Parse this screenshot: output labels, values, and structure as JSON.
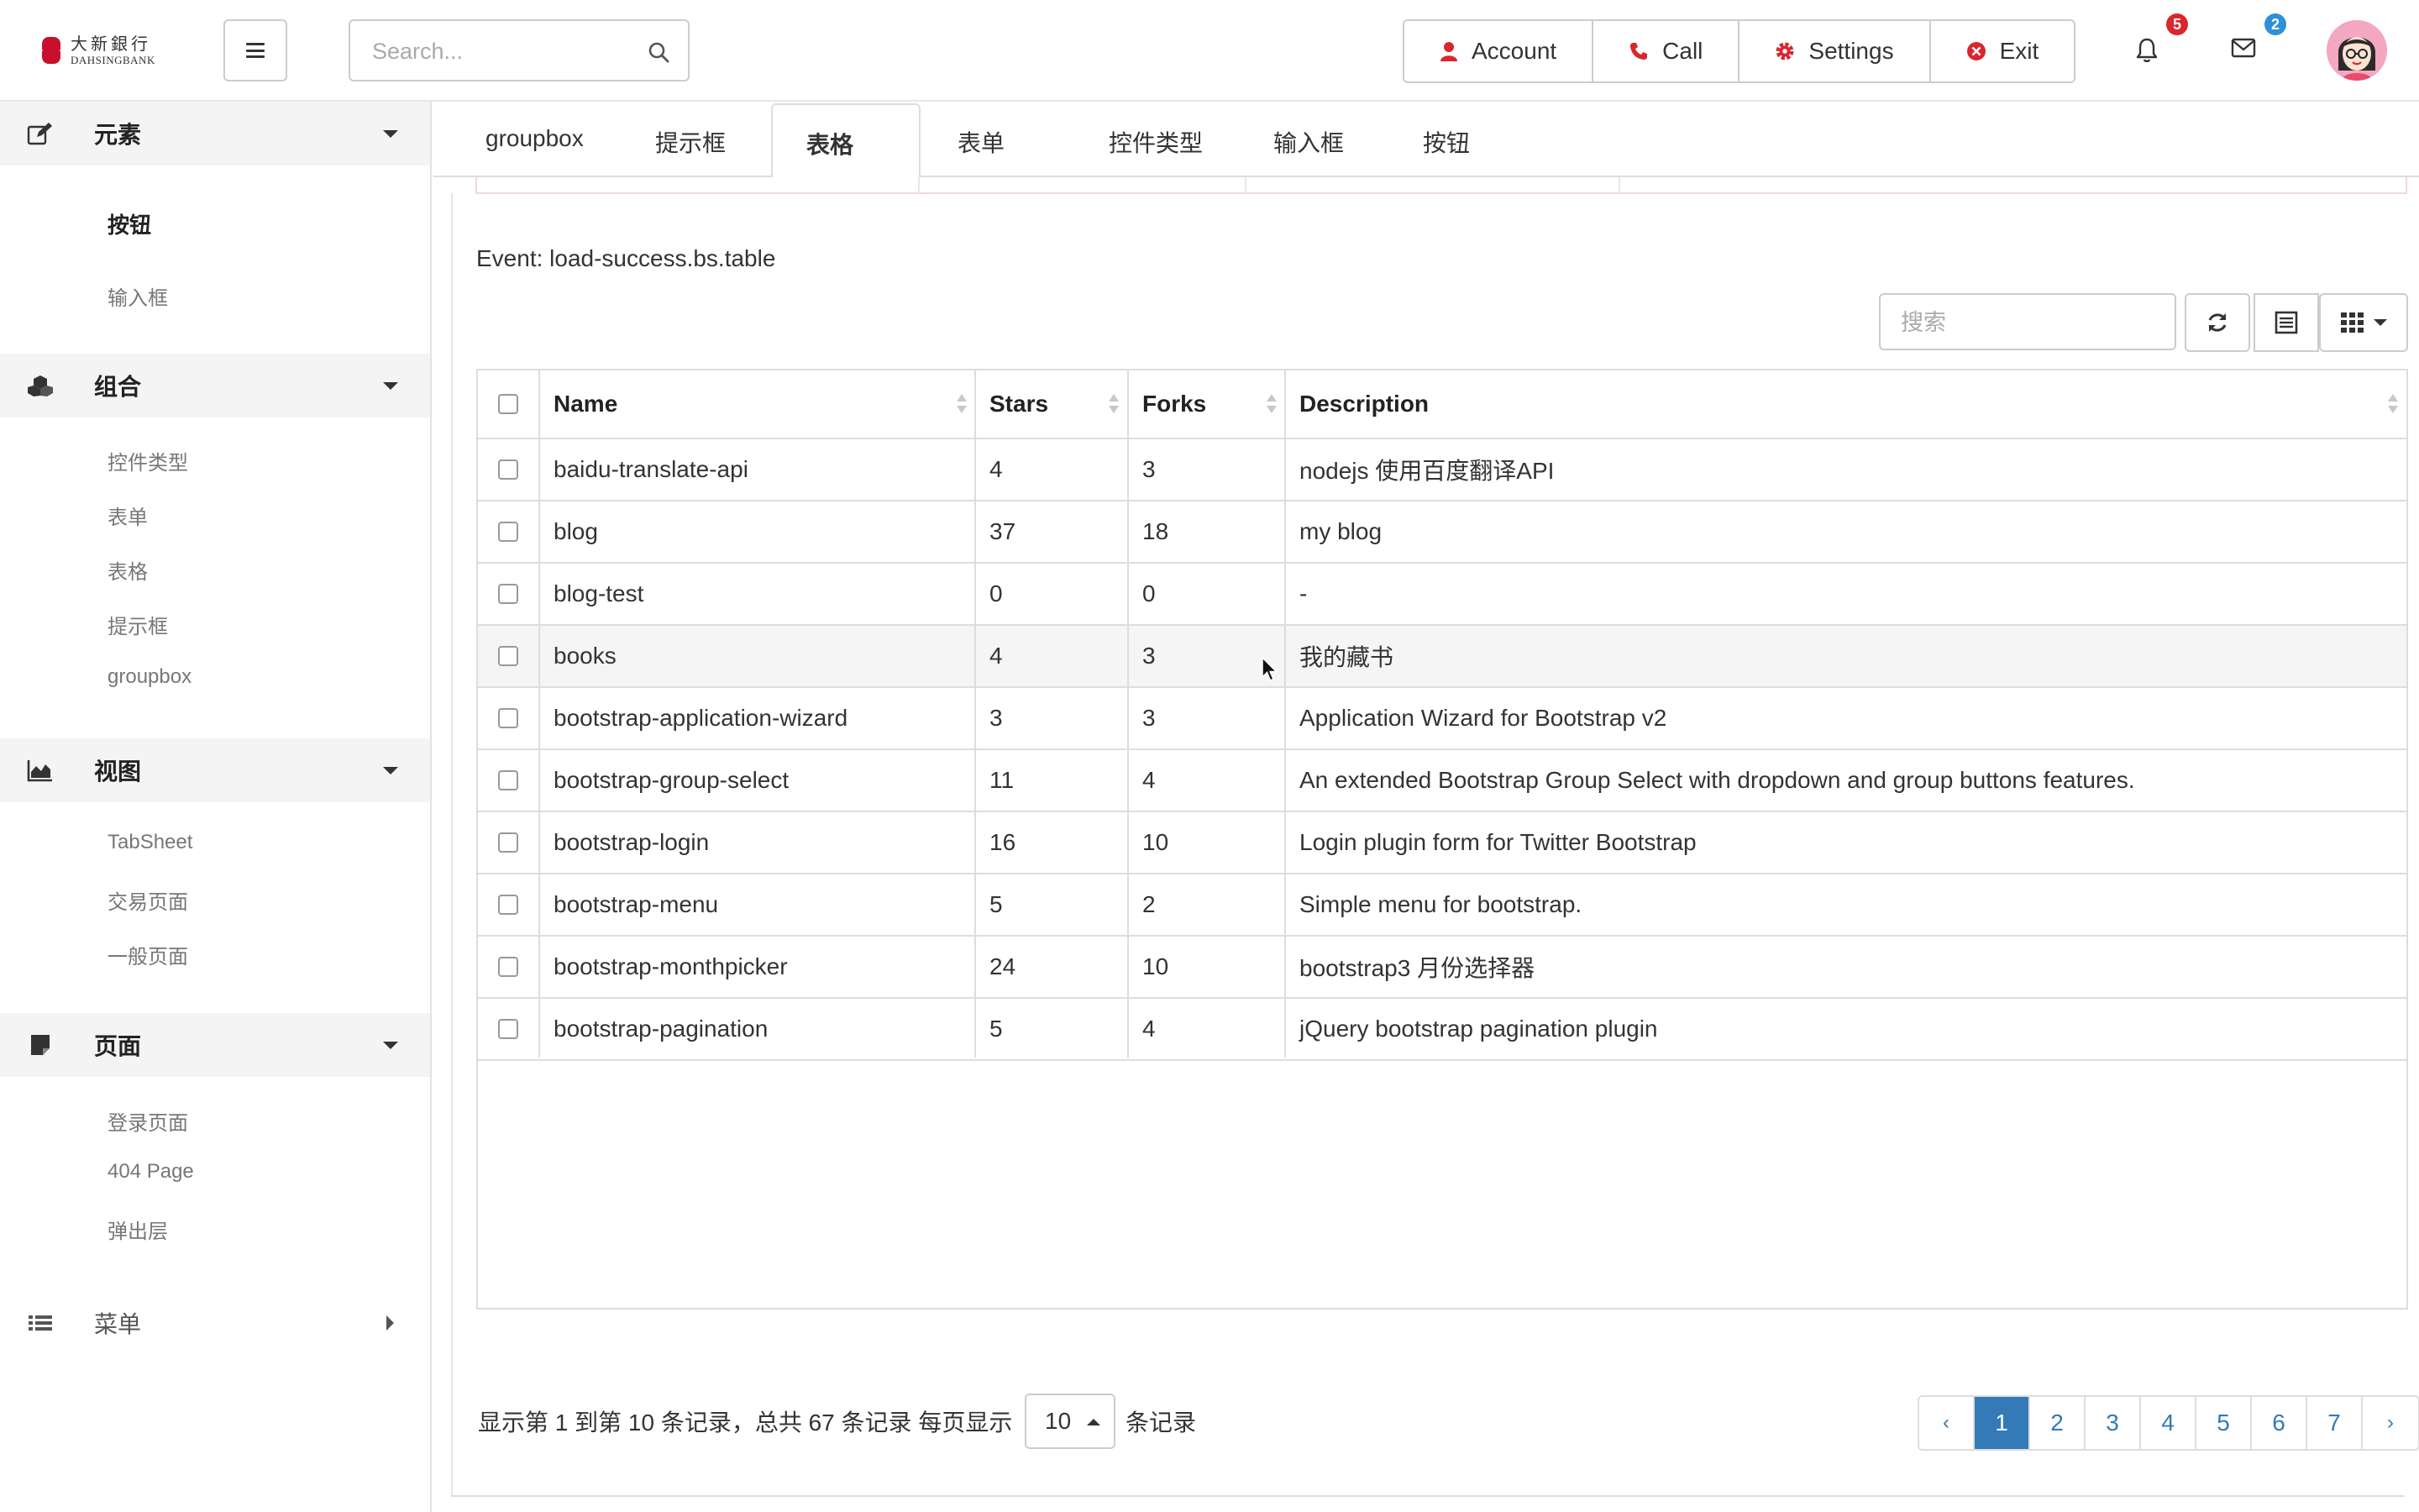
{
  "brand": {
    "name_cn": "大新銀行",
    "name_en": "DAHSINGBANK",
    "color": "#c8102e"
  },
  "header": {
    "search_placeholder": "Search...",
    "actions": [
      {
        "label": "Account",
        "icon": "user-icon"
      },
      {
        "label": "Call",
        "icon": "phone-icon"
      },
      {
        "label": "Settings",
        "icon": "gear-icon"
      },
      {
        "label": "Exit",
        "icon": "close-circle-icon"
      }
    ],
    "notifications": {
      "count": "5",
      "icon": "bell-icon",
      "color": "#d9262e"
    },
    "messages": {
      "count": "2",
      "icon": "envelope-icon",
      "color": "#2f8fd8"
    }
  },
  "sidebar": {
    "sections": [
      {
        "title": "元素",
        "icon": "edit-icon",
        "items": [
          {
            "label": "按钮",
            "active": true
          },
          {
            "label": "输入框"
          }
        ]
      },
      {
        "title": "组合",
        "icon": "cubes-icon",
        "items": [
          {
            "label": "控件类型"
          },
          {
            "label": "表单"
          },
          {
            "label": "表格"
          },
          {
            "label": "提示框"
          },
          {
            "label": "groupbox"
          }
        ]
      },
      {
        "title": "视图",
        "icon": "area-chart-icon",
        "items": [
          {
            "label": "TabSheet"
          },
          {
            "label": "交易页面"
          },
          {
            "label": "一般页面"
          }
        ]
      },
      {
        "title": "页面",
        "icon": "sticky-note-icon",
        "items": [
          {
            "label": "登录页面"
          },
          {
            "label": "404 Page"
          },
          {
            "label": "弹出层"
          }
        ]
      },
      {
        "title": "菜单",
        "icon": "list-icon",
        "items": []
      }
    ]
  },
  "tabs": [
    {
      "label": "groupbox"
    },
    {
      "label": "提示框"
    },
    {
      "label": "表格",
      "active": true
    },
    {
      "label": "表单"
    },
    {
      "label": "控件类型"
    },
    {
      "label": "输入框"
    },
    {
      "label": "按钮"
    }
  ],
  "event_text": "Event: load-success.bs.table",
  "table_toolbar": {
    "search_placeholder": "搜索"
  },
  "table": {
    "columns": [
      "Name",
      "Stars",
      "Forks",
      "Description"
    ],
    "rows": [
      {
        "name": "baidu-translate-api",
        "stars": "4",
        "forks": "3",
        "description": "nodejs 使用百度翻译API"
      },
      {
        "name": "blog",
        "stars": "37",
        "forks": "18",
        "description": "my blog"
      },
      {
        "name": "blog-test",
        "stars": "0",
        "forks": "0",
        "description": "-"
      },
      {
        "name": "books",
        "stars": "4",
        "forks": "3",
        "description": "我的藏书"
      },
      {
        "name": "bootstrap-application-wizard",
        "stars": "3",
        "forks": "3",
        "description": "Application Wizard for Bootstrap v2"
      },
      {
        "name": "bootstrap-group-select",
        "stars": "11",
        "forks": "4",
        "description": "An extended Bootstrap Group Select with dropdown and group buttons features."
      },
      {
        "name": "bootstrap-login",
        "stars": "16",
        "forks": "10",
        "description": "Login plugin form for Twitter Bootstrap"
      },
      {
        "name": "bootstrap-menu",
        "stars": "5",
        "forks": "2",
        "description": "Simple menu for bootstrap."
      },
      {
        "name": "bootstrap-monthpicker",
        "stars": "24",
        "forks": "10",
        "description": "bootstrap3 月份选择器"
      },
      {
        "name": "bootstrap-pagination",
        "stars": "5",
        "forks": "4",
        "description": "jQuery bootstrap pagination plugin"
      }
    ]
  },
  "pagination": {
    "summary": "显示第 1 到第 10 条记录，总共 67 条记录 每页显示",
    "page_size": "10",
    "suffix": "条记录",
    "prev": "‹",
    "next": "›",
    "pages": [
      "1",
      "2",
      "3",
      "4",
      "5",
      "6",
      "7"
    ],
    "current": "1",
    "accent": "#337ab7"
  }
}
